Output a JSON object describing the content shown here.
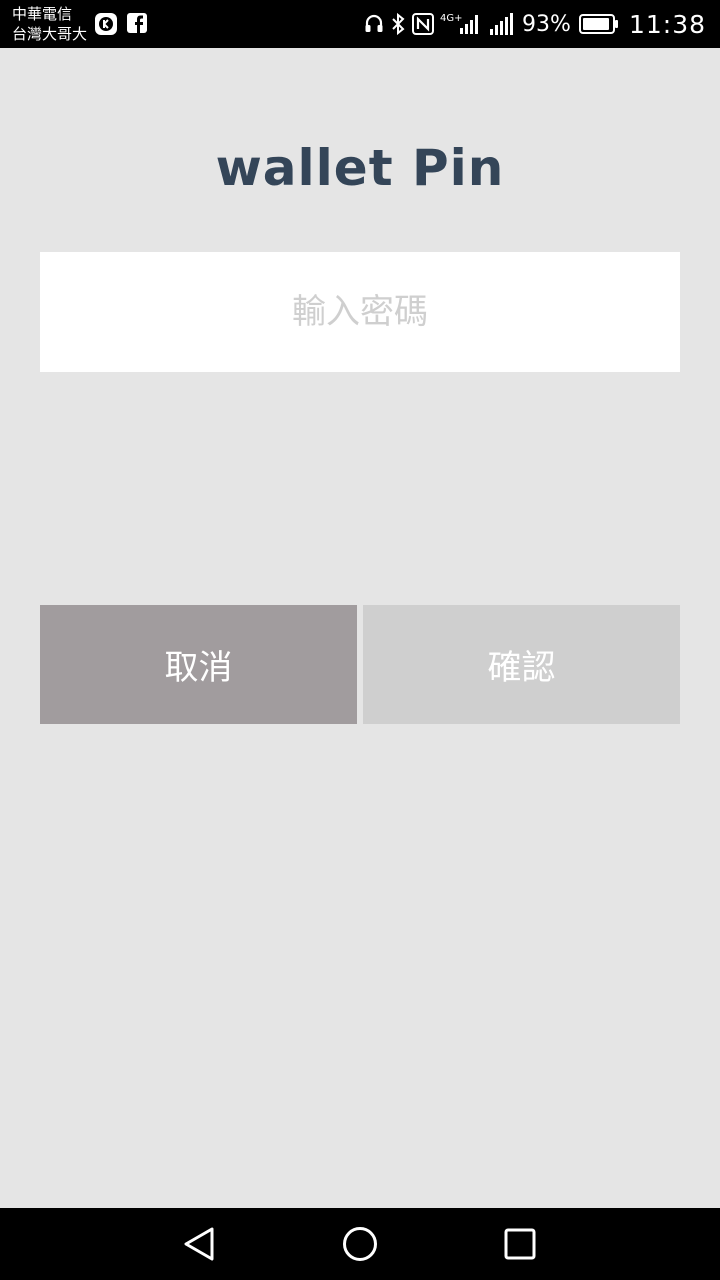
{
  "status_bar": {
    "carrier_1": "中華電信",
    "carrier_2": "台灣大哥大",
    "notification_icons": [
      "kkbox-icon",
      "facebook-icon"
    ],
    "system_icons": [
      "headset-icon",
      "bluetooth-icon",
      "nfc-icon",
      "signal-4g-icon",
      "signal-icon",
      "battery-icon"
    ],
    "network_label": "4G+",
    "battery_percent": "93%",
    "battery_level": 0.93,
    "time": "11:38"
  },
  "app": {
    "logo_text": "wallet Pin"
  },
  "pin_input": {
    "placeholder": "輸入密碼",
    "value": ""
  },
  "buttons": {
    "cancel_label": "取消",
    "confirm_label": "確認"
  },
  "nav_bar": {
    "icons": [
      "back-icon",
      "home-icon",
      "recents-icon"
    ]
  },
  "colors": {
    "background": "#e5e5e5",
    "logo": "#344558",
    "cancel_button": "#a19c9e",
    "confirm_button": "#cfcfcf",
    "placeholder": "#cfcfcf"
  }
}
